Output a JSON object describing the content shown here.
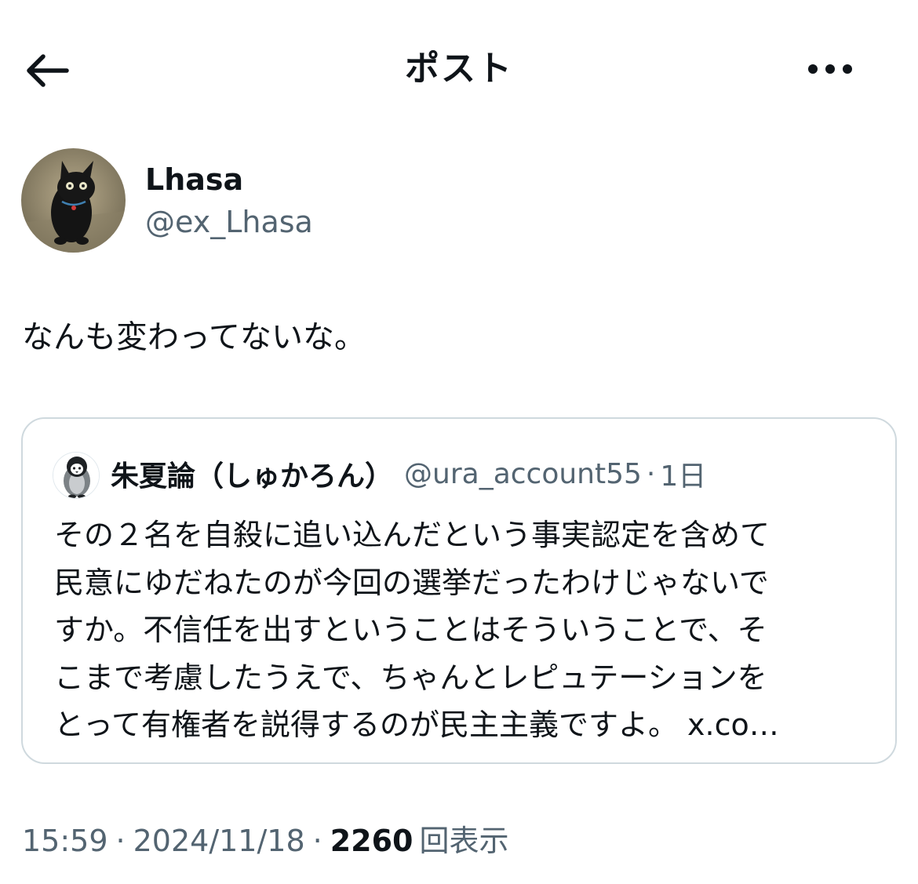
{
  "header": {
    "title": "ポスト",
    "back_icon": "arrow-left-icon",
    "more_icon": "more-horizontal-icon"
  },
  "author": {
    "name": "Lhasa",
    "handle": "@ex_Lhasa",
    "avatar": "black-cat-avatar"
  },
  "post": {
    "text": "なんも変わってないな。"
  },
  "quote": {
    "name": "朱夏論（しゅかろん）",
    "handle": "@ura_account55",
    "separator": "·",
    "time": "1日",
    "avatar": "penguin-avatar",
    "lines": [
      "その２名を自殺に追い込んだという事実認定を含めて",
      "民意にゆだねたのが今回の選挙だったわけじゃないで",
      "すか。不信任を出すということはそういうことで、そ",
      "こまで考慮したうえで、ちゃんとレピュテーションを",
      "とって有権者を説得するのが民主主義ですよ。 x.co…"
    ]
  },
  "meta": {
    "time": "15:59",
    "separator": "·",
    "date": "2024/11/18",
    "views_count": "2260",
    "views_label": "回表示"
  },
  "colors": {
    "text_primary": "#0f1419",
    "text_secondary": "#536471",
    "border": "#cfd9de"
  }
}
